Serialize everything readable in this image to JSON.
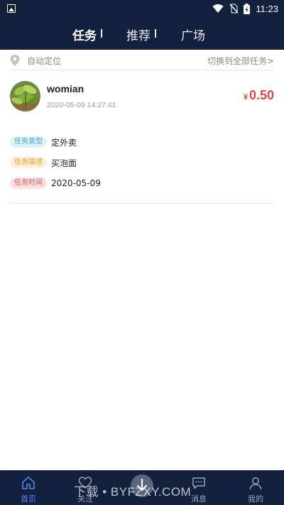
{
  "status_bar": {
    "time": "11:23"
  },
  "top_tabs": [
    {
      "label": "任务"
    },
    {
      "label": "推荐"
    },
    {
      "label": "广场"
    }
  ],
  "location": {
    "label": "自动定位",
    "switch_label": "切换到全部任务>"
  },
  "task": {
    "username": "womian",
    "timestamp": "2020-05-09 14:27:41",
    "price_symbol": "¥",
    "price": "0.50",
    "fields": [
      {
        "tag": "任务类型",
        "value": "定外卖"
      },
      {
        "tag": "任务描述",
        "value": "买泡面"
      },
      {
        "tag": "任务时间",
        "value": "2020-05-09"
      }
    ]
  },
  "bottom_nav": [
    {
      "label": "首页",
      "icon": "home-icon"
    },
    {
      "label": "关注",
      "icon": "heart-icon"
    },
    {
      "label": "",
      "icon": "publish-icon"
    },
    {
      "label": "消息",
      "icon": "message-icon"
    },
    {
      "label": "我的",
      "icon": "profile-icon"
    }
  ],
  "watermark": {
    "text": "下载 • BYFZXY.COM"
  },
  "colors": {
    "nav_bg": "#13213f",
    "price": "#e8453c",
    "active_tab": "#4a8fe8"
  }
}
